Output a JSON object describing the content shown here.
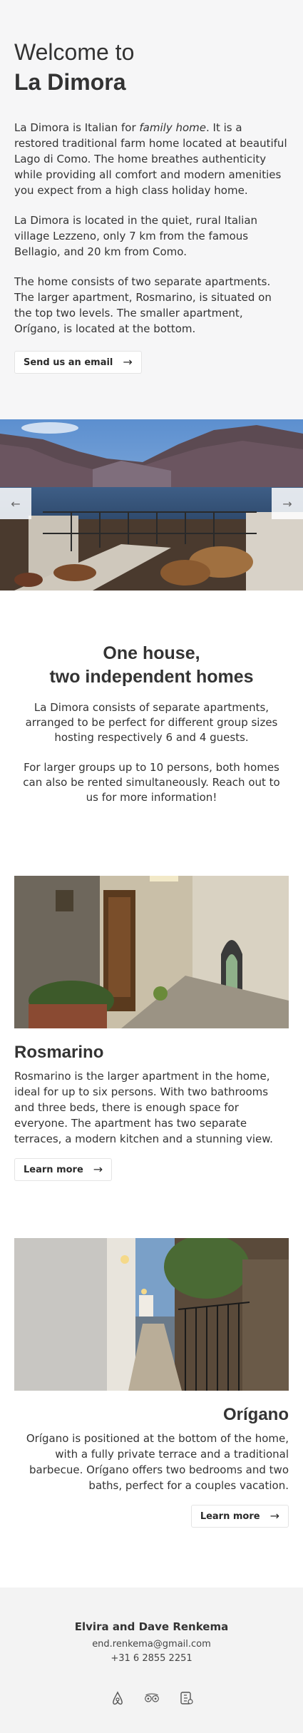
{
  "hero": {
    "title_line1": "Welcome to",
    "title_line2": "La Dimora",
    "para1_before": "La Dimora is Italian for ",
    "para1_em": "family home",
    "para1_after": ". It is a restored traditional farm home located at beautiful Lago di Como. The home breathes authenticity while providing all comfort and modern amenities you expect from a high class holiday home.",
    "para2": "La Dimora is located in the quiet, rural Italian village Lezzeno, only 7 km from the famous Bellagio, and 20 km from Como.",
    "para3": "The home consists of two separate apartments. The larger apartment, Rosmarino, is situated on the top two levels. The smaller apartment, Orígano, is located at the bottom.",
    "email_button": "Send us an email"
  },
  "slider": {
    "prev_icon": "arrow-left-icon",
    "next_icon": "arrow-right-icon",
    "prev_glyph": "←",
    "next_glyph": "→"
  },
  "intro": {
    "heading_line1": "One house,",
    "heading_line2": "two independent homes",
    "para1": "La Dimora consists of separate apartments, arranged to be perfect for different group sizes hosting respectively 6 and 4 guests.",
    "para2": "For larger groups up to 10 persons, both homes can also be rented simultaneously. Reach out to us for more information!"
  },
  "apartments": [
    {
      "name": "Rosmarino",
      "description": "Rosmarino is the larger apartment in the home, ideal for up to six persons. With two bathrooms and three beds, there is enough space for everyone. The apartment has two separate terraces, a modern kitchen and a stunning view.",
      "button": "Learn more"
    },
    {
      "name": "Orígano",
      "description": "Orígano is positioned at the bottom of the home, with a fully private terrace and a traditional barbecue. Orígano offers two bedrooms and two baths, perfect for a couples vacation.",
      "button": "Learn more"
    }
  ],
  "footer": {
    "name": "Elvira and Dave Renkema",
    "email": "end.renkema@gmail.com",
    "phone": "+31 6 2855 2251",
    "social_icons": [
      "airbnb-icon",
      "tripadvisor-icon",
      "booking-icon"
    ]
  },
  "colors": {
    "hero_bg": "#f6f6f7",
    "footer_bg": "#f3f3f3",
    "text": "#333333"
  }
}
